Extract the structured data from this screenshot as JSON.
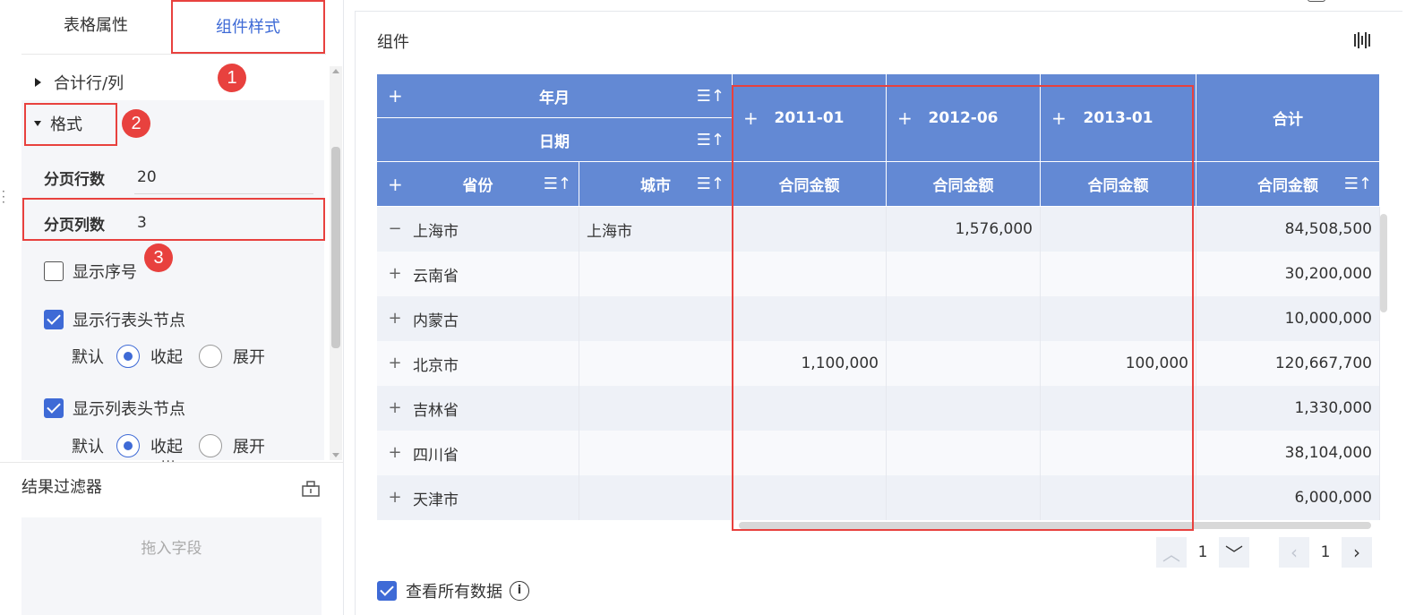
{
  "left_panel": {
    "tabs": {
      "table_props": "表格属性",
      "component_style": "组件样式"
    },
    "sections": {
      "total_row_col": "合计行/列",
      "format": "格式"
    },
    "form": {
      "rows_per_page_label": "分页行数",
      "rows_per_page_value": "20",
      "cols_per_page_label": "分页列数",
      "cols_per_page_value": "3"
    },
    "checks": {
      "show_index": "显示序号",
      "show_row_header_nodes": "显示行表头节点",
      "show_col_header_nodes": "显示列表头节点"
    },
    "radio": {
      "default_label": "默认",
      "collapse": "收起",
      "expand": "展开"
    },
    "badges": [
      "1",
      "2",
      "3"
    ],
    "filter": {
      "title": "结果过滤器",
      "drop_placeholder": "拖入字段"
    }
  },
  "widget": {
    "title": "组件",
    "header": {
      "year_month": "年月",
      "date": "日期",
      "province": "省份",
      "city": "城市",
      "columns": [
        "2011-01",
        "2012-06",
        "2013-01"
      ],
      "total": "合计",
      "measure": "合同金额"
    },
    "rows": [
      {
        "province": "上海市",
        "city": "上海市",
        "expanded": true,
        "c1": "",
        "c2": "1,576,000",
        "c3": "",
        "total": "84,508,500"
      },
      {
        "province": "云南省",
        "city": "",
        "expanded": false,
        "c1": "",
        "c2": "",
        "c3": "",
        "total": "30,200,000"
      },
      {
        "province": "内蒙古",
        "city": "",
        "expanded": false,
        "c1": "",
        "c2": "",
        "c3": "",
        "total": "10,000,000"
      },
      {
        "province": "北京市",
        "city": "",
        "expanded": false,
        "c1": "1,100,000",
        "c2": "",
        "c3": "100,000",
        "total": "120,667,700"
      },
      {
        "province": "吉林省",
        "city": "",
        "expanded": false,
        "c1": "",
        "c2": "",
        "c3": "",
        "total": "1,330,000"
      },
      {
        "province": "四川省",
        "city": "",
        "expanded": false,
        "c1": "",
        "c2": "",
        "c3": "",
        "total": "38,104,000"
      },
      {
        "province": "天津市",
        "city": "",
        "expanded": false,
        "c1": "",
        "c2": "",
        "c3": "",
        "total": "6,000,000"
      }
    ],
    "pager": {
      "row_page": "1",
      "col_page": "1"
    },
    "view_all": "查看所有数据"
  },
  "colors": {
    "accent": "#3e6ad6",
    "header_bg": "#6389d4",
    "highlight": "#e8413e"
  }
}
